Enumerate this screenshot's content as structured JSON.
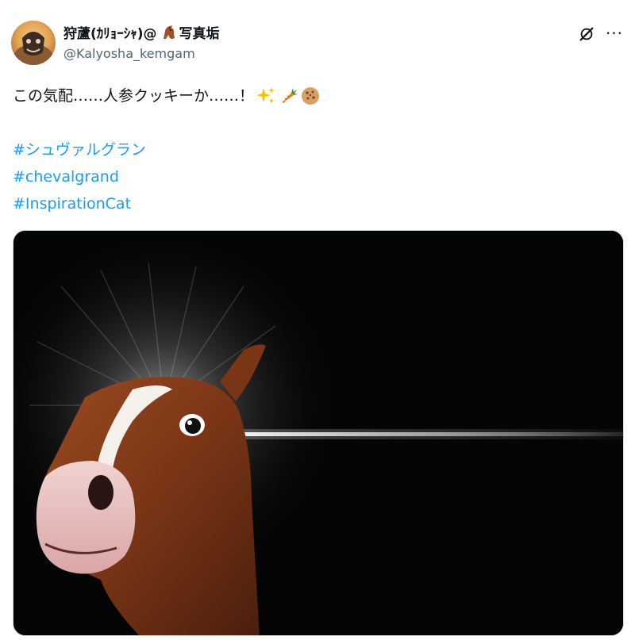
{
  "tweet": {
    "author": {
      "display_name": "狩蘆(ｶﾘｮｰｼｬ)@",
      "name_suffix": "写真垢",
      "name_emoji": "horse-face",
      "handle": "@Kalyosha_kemgam",
      "avatar": "avatar-image"
    },
    "header_icons": [
      "grok-icon",
      "more-icon"
    ],
    "more_label": "···",
    "text": "この気配……人参クッキーか……！",
    "emojis": [
      "sparkles",
      "carrot",
      "cookie"
    ],
    "hashtags": [
      "#シュヴァルグラン",
      "#chevalgrand",
      "#InspirationCat"
    ],
    "media": {
      "type": "photo",
      "subject": "horse-head-with-light-beam"
    }
  },
  "colors": {
    "text": "#0f1419",
    "secondary": "#536471",
    "link": "#1d9bf0",
    "media_bg": "#050505"
  }
}
